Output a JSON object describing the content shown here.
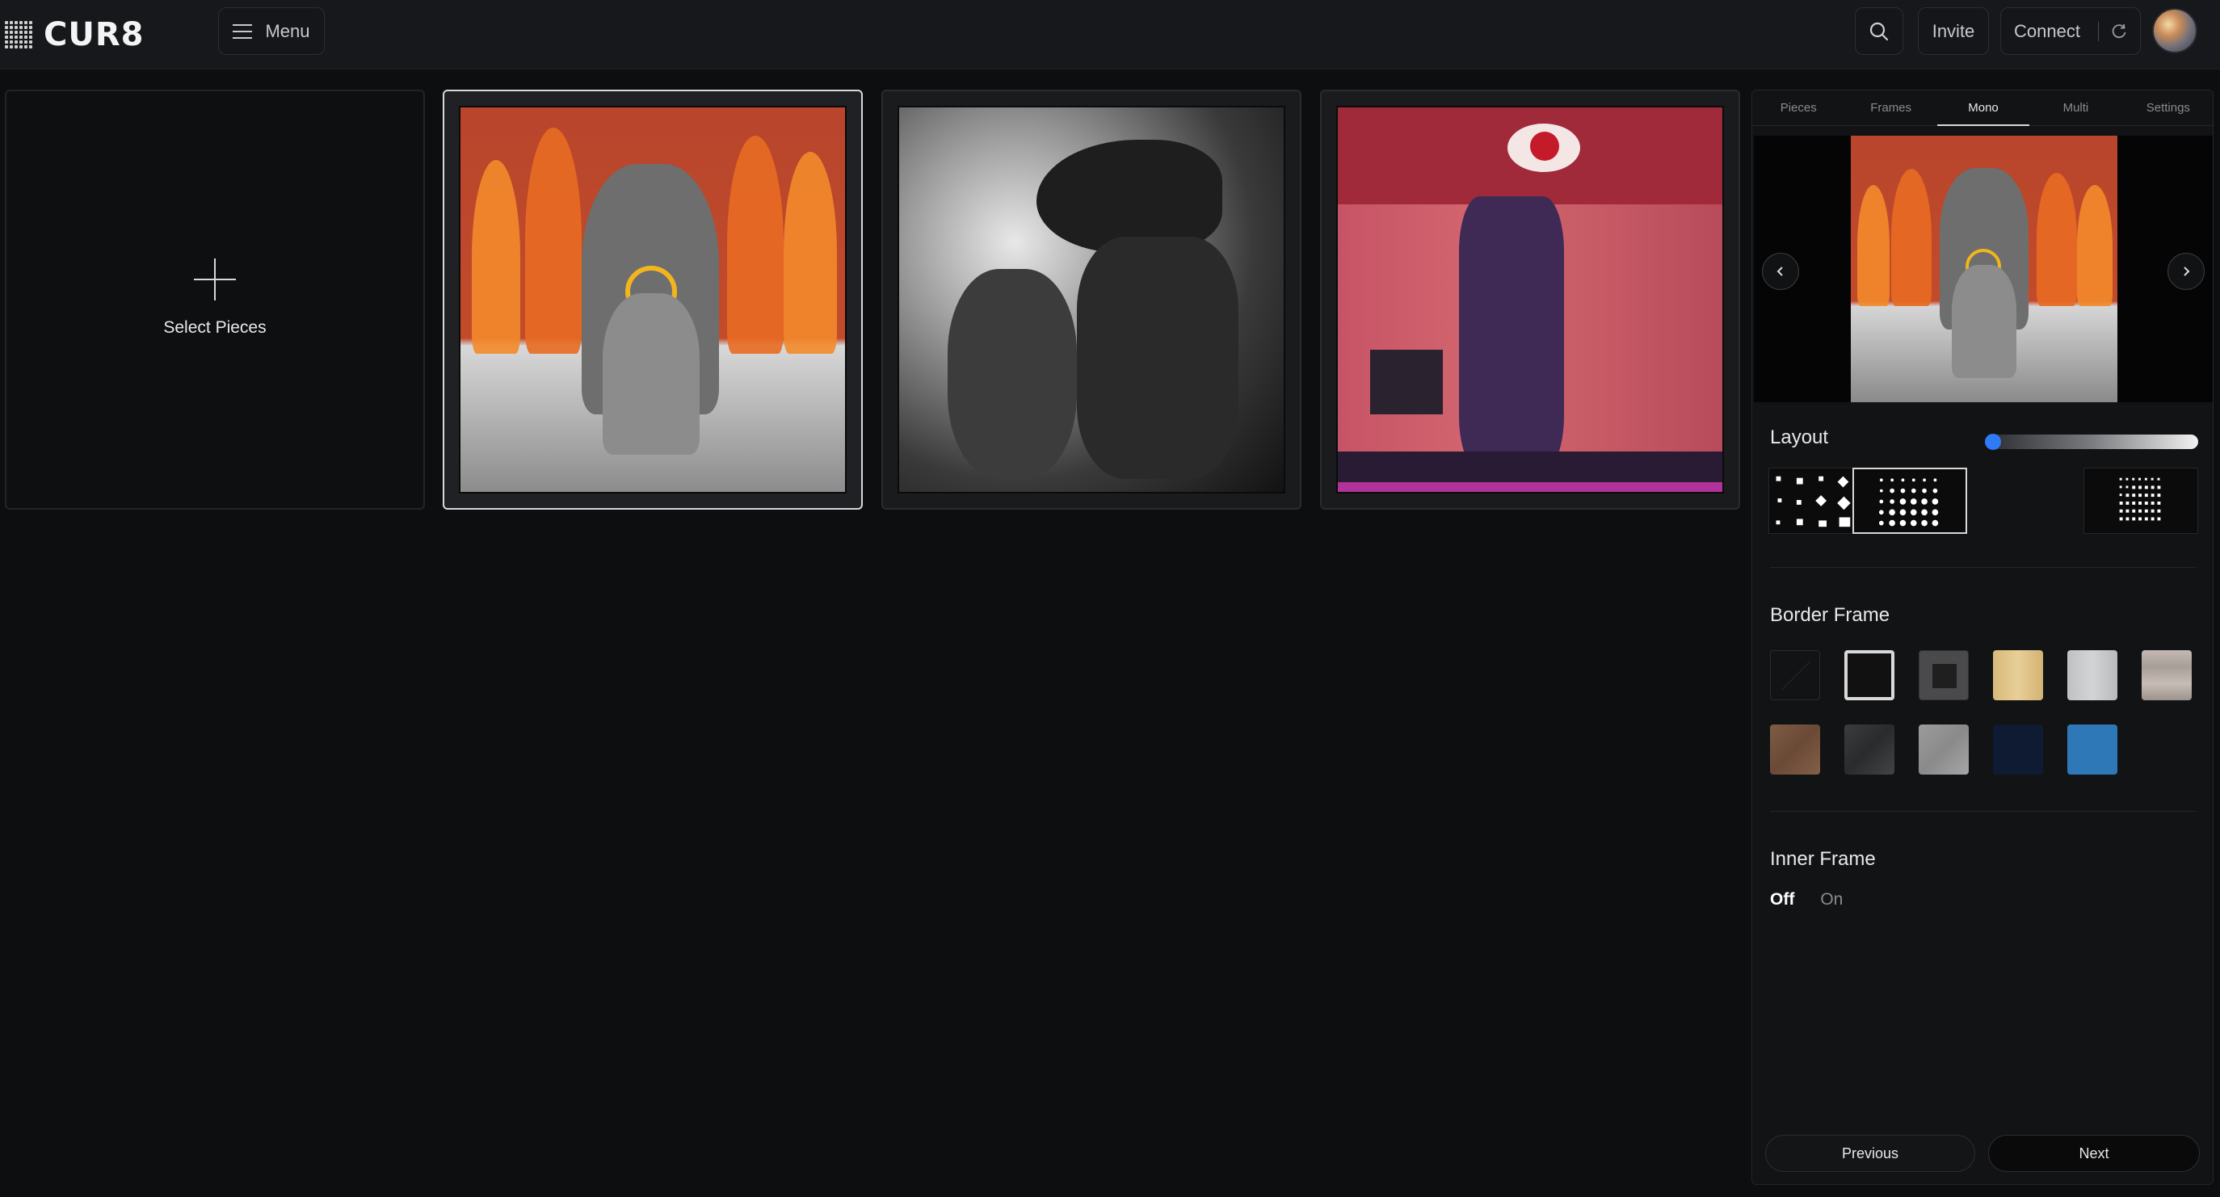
{
  "header": {
    "logo_text": "CUR8",
    "menu_label": "Menu",
    "invite_label": "Invite",
    "connect_label": "Connect"
  },
  "gallery": {
    "select_label": "Select Pieces"
  },
  "panel": {
    "tabs": [
      "Pieces",
      "Frames",
      "Mono",
      "Multi",
      "Settings"
    ],
    "active_tab": "Mono",
    "layout_title": "Layout",
    "layout_slider_value": 0,
    "border_frame_title": "Border Frame",
    "inner_frame_title": "Inner Frame",
    "inner_frame_options": {
      "off": "Off",
      "on": "On"
    },
    "inner_frame_selected": "Off",
    "previous_label": "Previous",
    "next_label": "Next"
  },
  "colors": {
    "accent": "#2f7bf5",
    "background": "#0d0e10",
    "swatches": [
      "#111111",
      "#d9d9d9",
      "#4a4a4c",
      "#e0c48a",
      "#c9cbcc",
      "#b9b0aa",
      "#7a5a45",
      "#3a3b3c",
      "#9a9a9a",
      "#0e1b33",
      "#2f78b8"
    ]
  }
}
